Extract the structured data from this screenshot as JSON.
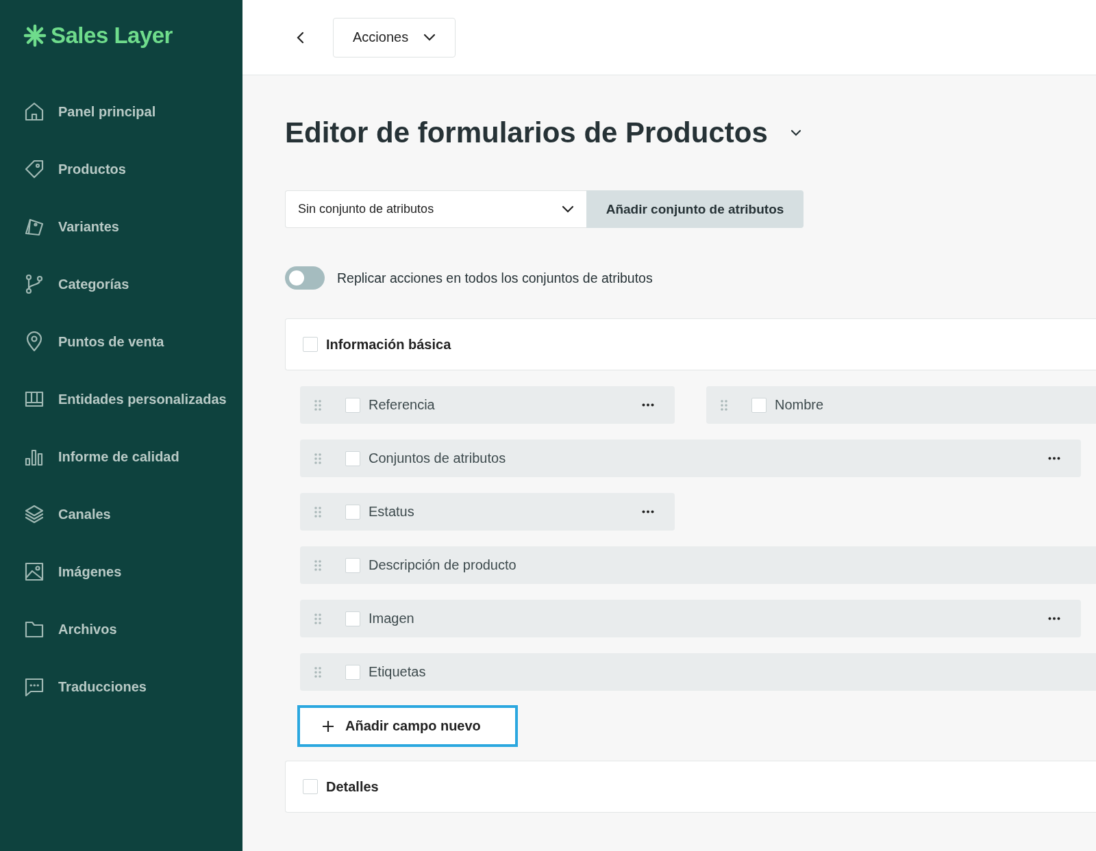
{
  "sidebar": {
    "logo": "Sales Layer",
    "items": [
      {
        "label": "Panel principal",
        "kind": "home"
      },
      {
        "label": "Productos",
        "kind": "tag"
      },
      {
        "label": "Variantes",
        "kind": "variants"
      },
      {
        "label": "Categorías",
        "kind": "branch"
      },
      {
        "label": "Puntos de venta",
        "kind": "pin"
      },
      {
        "label": "Entidades personalizadas",
        "kind": "table"
      },
      {
        "label": "Informe de calidad",
        "kind": "bars"
      },
      {
        "label": "Canales",
        "kind": "layers"
      },
      {
        "label": "Imágenes",
        "kind": "image"
      },
      {
        "label": "Archivos",
        "kind": "folder"
      },
      {
        "label": "Traducciones",
        "kind": "chat"
      }
    ]
  },
  "topbar": {
    "actions_button": "Acciones"
  },
  "title": "Editor de formularios de Productos",
  "attribute_set_select": {
    "value": "Sin conjunto de atributos"
  },
  "add_attribute_set_button": "Añadir conjunto de atributos",
  "replicate_toggle": {
    "label": "Replicar acciones en todos los conjuntos de atributos",
    "on": false
  },
  "sections": [
    {
      "title": "Información básica",
      "checked": false,
      "rows": [
        [
          {
            "label": "Referencia",
            "checked": false,
            "menu": true,
            "kind": "half"
          },
          {
            "label": "Nombre",
            "checked": false,
            "kind": "wide"
          }
        ],
        [
          {
            "label": "Conjuntos de atributos",
            "checked": false,
            "menu": true,
            "kind": "full"
          }
        ],
        [
          {
            "label": "Estatus",
            "checked": false,
            "menu": true,
            "kind": "half"
          }
        ],
        [
          {
            "label": "Descripción de producto",
            "checked": false,
            "kind": "wide"
          }
        ],
        [
          {
            "label": "Imagen",
            "checked": false,
            "menu": true,
            "kind": "full"
          }
        ],
        [
          {
            "label": "Etiquetas",
            "checked": false,
            "kind": "wide"
          }
        ]
      ],
      "add_field_button": "Añadir campo nuevo"
    },
    {
      "title": "Detalles",
      "checked": false
    }
  ]
}
